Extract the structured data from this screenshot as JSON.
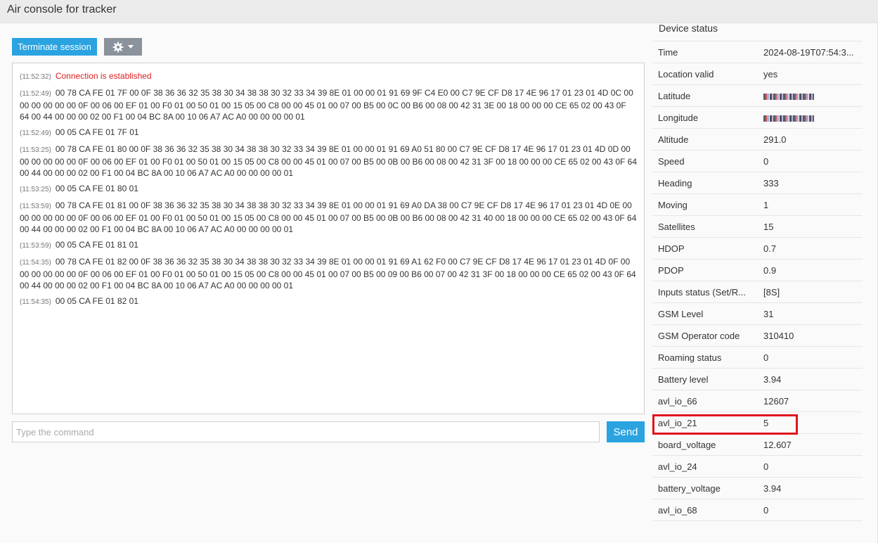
{
  "window": {
    "title": "Air console for tracker"
  },
  "toolbar": {
    "terminate_label": "Terminate session",
    "settings_icon": "gear-icon"
  },
  "console": {
    "entries": [
      {
        "time": "(11:52:32)",
        "text": "Connection is established",
        "style": "red"
      },
      {
        "time": "(11:52:49)",
        "text": "00 78 CA FE 01 7F 00 0F 38 36 36 32 35 38 30 34 38 38 30 32 33 34 39 8E 01 00 00 01 91 69 9F C4 E0 00 C7 9E CF D8 17 4E 96 17 01 23 01 4D 0C 00 00 00 00 00 00 0F 00 06 00 EF 01 00 F0 01 00 50 01 00 15 05 00 C8 00 00 45 01 00 07 00 B5 00 0C 00 B6 00 08 00 42 31 3E 00 18 00 00 00 CE 65 02 00 43 0F 64 00 44 00 00 00 02 00 F1 00 04 BC 8A 00 10 06 A7 AC A0 00 00 00 00 01"
      },
      {
        "time": "(11:52:49)",
        "text": "00 05 CA FE 01 7F 01"
      },
      {
        "time": "(11:53:25)",
        "text": "00 78 CA FE 01 80 00 0F 38 36 36 32 35 38 30 34 38 38 30 32 33 34 39 8E 01 00 00 01 91 69 A0 51 80 00 C7 9E CF D8 17 4E 96 17 01 23 01 4D 0D 00 00 00 00 00 00 0F 00 06 00 EF 01 00 F0 01 00 50 01 00 15 05 00 C8 00 00 45 01 00 07 00 B5 00 0B 00 B6 00 08 00 42 31 3F 00 18 00 00 00 CE 65 02 00 43 0F 64 00 44 00 00 00 02 00 F1 00 04 BC 8A 00 10 06 A7 AC A0 00 00 00 00 01"
      },
      {
        "time": "(11:53:25)",
        "text": "00 05 CA FE 01 80 01"
      },
      {
        "time": "(11:53:59)",
        "text": "00 78 CA FE 01 81 00 0F 38 36 36 32 35 38 30 34 38 38 30 32 33 34 39 8E 01 00 00 01 91 69 A0 DA 38 00 C7 9E CF D8 17 4E 96 17 01 23 01 4D 0E 00 00 00 00 00 00 0F 00 06 00 EF 01 00 F0 01 00 50 01 00 15 05 00 C8 00 00 45 01 00 07 00 B5 00 0B 00 B6 00 08 00 42 31 40 00 18 00 00 00 CE 65 02 00 43 0F 64 00 44 00 00 00 02 00 F1 00 04 BC 8A 00 10 06 A7 AC A0 00 00 00 00 01"
      },
      {
        "time": "(11:53:59)",
        "text": "00 05 CA FE 01 81 01"
      },
      {
        "time": "(11:54:35)",
        "text": "00 78 CA FE 01 82 00 0F 38 36 36 32 35 38 30 34 38 38 30 32 33 34 39 8E 01 00 00 01 91 69 A1 62 F0 00 C7 9E CF D8 17 4E 96 17 01 23 01 4D 0F 00 00 00 00 00 00 0F 00 06 00 EF 01 00 F0 01 00 50 01 00 15 05 00 C8 00 00 45 01 00 07 00 B5 00 09 00 B6 00 07 00 42 31 3F 00 18 00 00 00 CE 65 02 00 43 0F 64 00 44 00 00 00 02 00 F1 00 04 BC 8A 00 10 06 A7 AC A0 00 00 00 00 01"
      },
      {
        "time": "(11:54:35)",
        "text": "00 05 CA FE 01 82 01"
      }
    ]
  },
  "command": {
    "placeholder": "Type the command",
    "send_label": "Send"
  },
  "status": {
    "title": "Device status",
    "rows": [
      {
        "key": "Time",
        "value": "2024-08-19T07:54:3..."
      },
      {
        "key": "Location valid",
        "value": "yes"
      },
      {
        "key": "Latitude",
        "value": "",
        "redacted": true
      },
      {
        "key": "Longitude",
        "value": "",
        "redacted": true
      },
      {
        "key": "Altitude",
        "value": "291.0"
      },
      {
        "key": "Speed",
        "value": "0"
      },
      {
        "key": "Heading",
        "value": "333"
      },
      {
        "key": "Moving",
        "value": "1"
      },
      {
        "key": "Satellites",
        "value": "15"
      },
      {
        "key": "HDOP",
        "value": "0.7"
      },
      {
        "key": "PDOP",
        "value": "0.9"
      },
      {
        "key": "Inputs status (Set/R...",
        "value": "[8S]"
      },
      {
        "key": "GSM Level",
        "value": "31"
      },
      {
        "key": "GSM Operator code",
        "value": "310410"
      },
      {
        "key": "Roaming status",
        "value": "0"
      },
      {
        "key": "Battery level",
        "value": "3.94"
      },
      {
        "key": "avl_io_66",
        "value": "12607",
        "highlighted": true
      },
      {
        "key": "avl_io_21",
        "value": "5"
      },
      {
        "key": "board_voltage",
        "value": "12.607"
      },
      {
        "key": "avl_io_24",
        "value": "0"
      },
      {
        "key": "battery_voltage",
        "value": "3.94"
      },
      {
        "key": "avl_io_68",
        "value": "0"
      }
    ]
  },
  "colors": {
    "accent": "#2aa3e0",
    "highlight": "#e0141e",
    "error_text": "#e02020"
  }
}
